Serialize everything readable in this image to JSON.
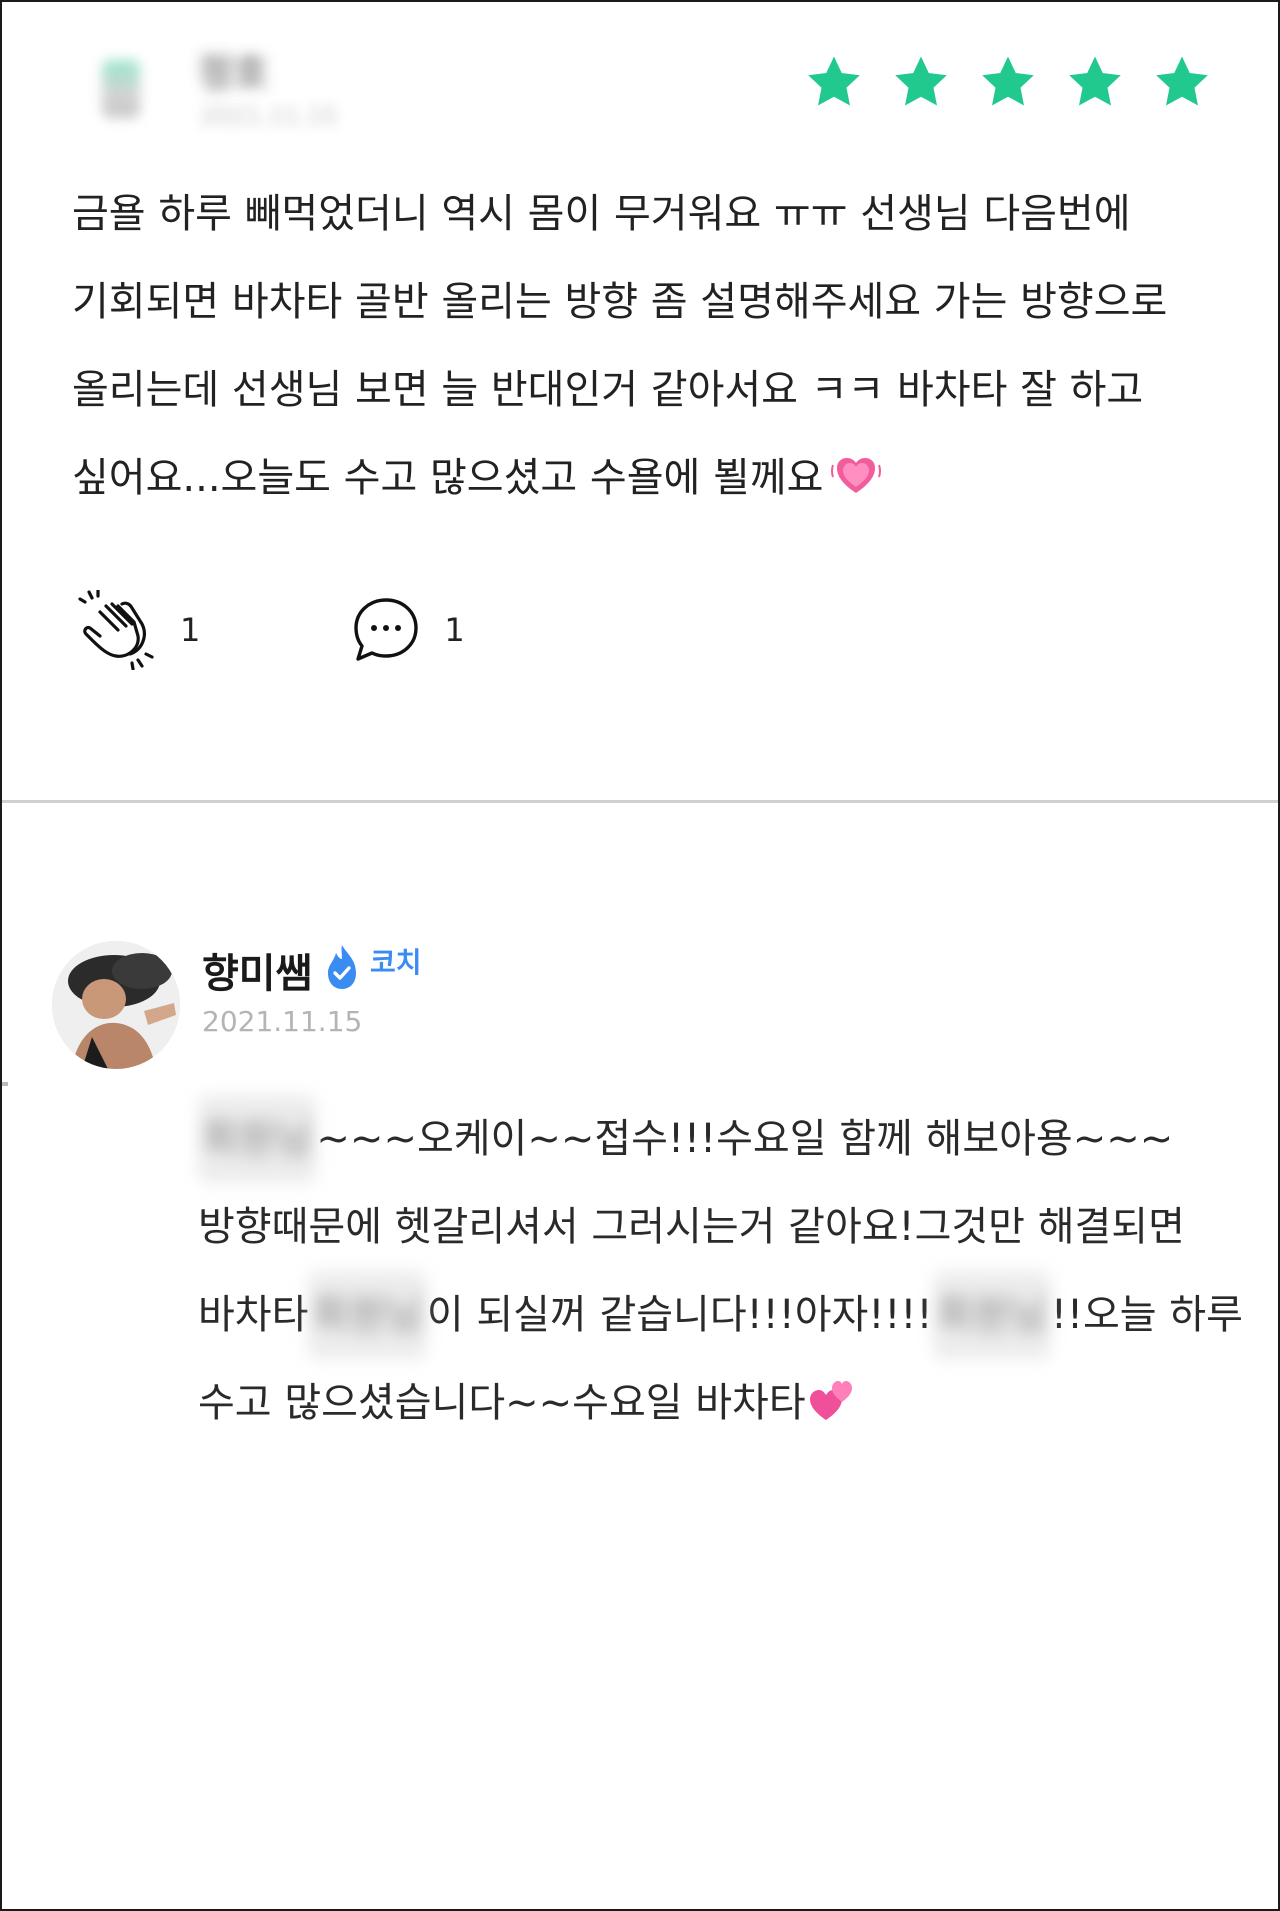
{
  "review": {
    "user_name": "정호",
    "date": "2021.11.15",
    "rating": 5,
    "star_color": "#22c98f",
    "text": "금욜 하루 빼먹었더니 역시 몸이 무거워요 ㅠㅠ 선생님 다음번에 기회되면 바차타 골반 올리는 방향 좀 설명해주세요 가는 방향으로 올리는데 선생님 보면 늘 반대인거 같아서요 ㅋㅋ 바차타 잘 하고 싶어요...오늘도 수고 많으셨고 수욜에 뵐께요",
    "text_emoji": "heart-pulse-emoji",
    "claps_count": "1",
    "comments_count": "1"
  },
  "reply": {
    "coach_name": "향미쌤",
    "coach_badge": "코치",
    "badge_color": "#3b8cf2",
    "date": "2021.11.15",
    "blurred_name": "회원님",
    "segments": {
      "s1": "~~~오케이~~접수!!!수요일 함께 해보아용~~~방향때문에 헷갈리셔서 그러시는거 같아요!그것만 해결되면 바차타",
      "s2": "이 되실꺼 같습니다!!!아자!!!!",
      "s3": "!!오늘 하루 수고 많으셨습니다~~수요일 바차타"
    },
    "end_emoji": "two-hearts-emoji"
  }
}
